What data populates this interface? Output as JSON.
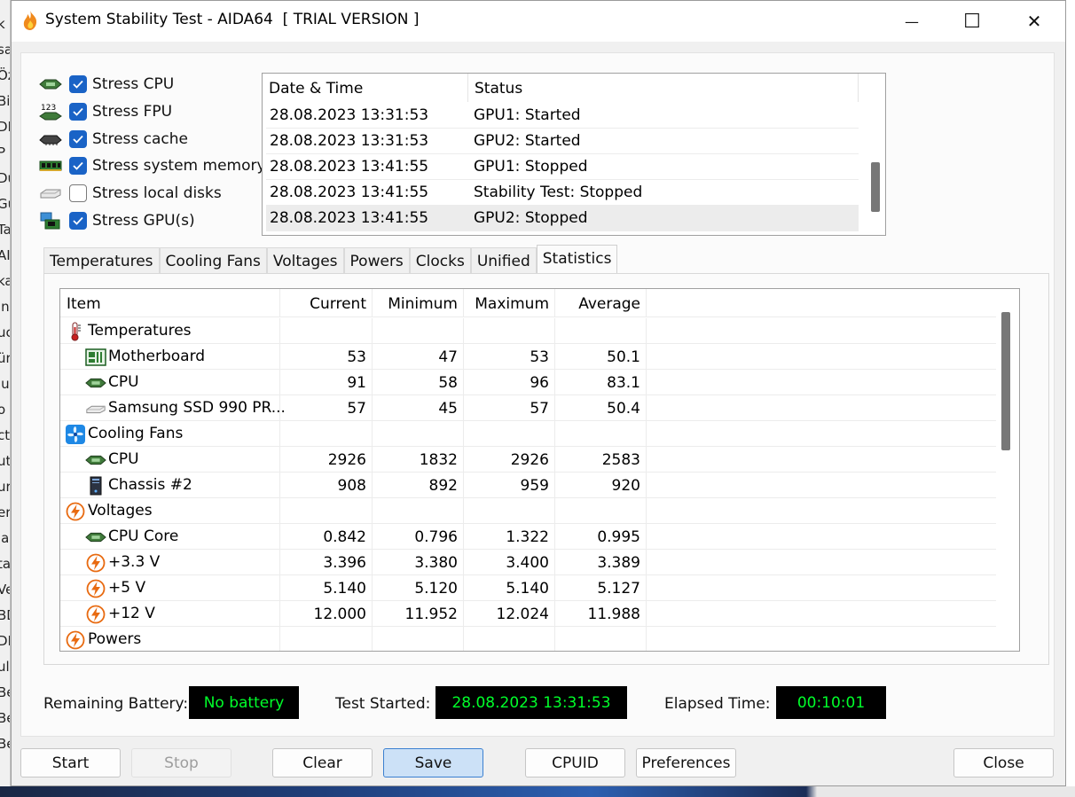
{
  "window": {
    "title": "System Stability Test - AIDA64  [ TRIAL VERSION ]",
    "minimize_glyph": "—",
    "maximize_glyph": "☐",
    "close_glyph": "✕"
  },
  "stress_options": [
    {
      "label": "Stress CPU",
      "checked": true,
      "icon": "cpu-chip-icon"
    },
    {
      "label": "Stress FPU",
      "checked": true,
      "icon": "fpu-icon"
    },
    {
      "label": "Stress cache",
      "checked": true,
      "icon": "cache-chip-icon"
    },
    {
      "label": "Stress system memory",
      "checked": true,
      "icon": "memory-module-icon"
    },
    {
      "label": "Stress local disks",
      "checked": false,
      "icon": "disk-icon"
    },
    {
      "label": "Stress GPU(s)",
      "checked": true,
      "icon": "gpu-icon"
    }
  ],
  "fpu_icon_text": "123",
  "log": {
    "headers": [
      "Date & Time",
      "Status"
    ],
    "rows": [
      {
        "time": "28.08.2023 13:31:53",
        "status": "GPU1: Started"
      },
      {
        "time": "28.08.2023 13:31:53",
        "status": "GPU2: Started"
      },
      {
        "time": "28.08.2023 13:41:55",
        "status": "GPU1: Stopped"
      },
      {
        "time": "28.08.2023 13:41:55",
        "status": "Stability Test: Stopped"
      },
      {
        "time": "28.08.2023 13:41:55",
        "status": "GPU2: Stopped"
      }
    ]
  },
  "tabs": [
    "Temperatures",
    "Cooling Fans",
    "Voltages",
    "Powers",
    "Clocks",
    "Unified",
    "Statistics"
  ],
  "active_tab": "Statistics",
  "stats": {
    "headers": {
      "item": "Item",
      "current": "Current",
      "minimum": "Minimum",
      "maximum": "Maximum",
      "average": "Average"
    },
    "rows": [
      {
        "type": "group",
        "icon": "thermometer-icon",
        "item": "Temperatures",
        "current": "",
        "minimum": "",
        "maximum": "",
        "average": ""
      },
      {
        "type": "item",
        "icon": "motherboard-icon",
        "item": "Motherboard",
        "current": "53",
        "minimum": "47",
        "maximum": "53",
        "average": "50.1"
      },
      {
        "type": "item",
        "icon": "cpu-chip-icon",
        "item": "CPU",
        "current": "91",
        "minimum": "58",
        "maximum": "96",
        "average": "83.1"
      },
      {
        "type": "item",
        "icon": "ssd-icon",
        "item": "Samsung SSD 990 PR...",
        "current": "57",
        "minimum": "45",
        "maximum": "57",
        "average": "50.4"
      },
      {
        "type": "group",
        "icon": "fan-icon",
        "item": "Cooling Fans",
        "current": "",
        "minimum": "",
        "maximum": "",
        "average": ""
      },
      {
        "type": "item",
        "icon": "cpu-chip-icon",
        "item": "CPU",
        "current": "2926",
        "minimum": "1832",
        "maximum": "2926",
        "average": "2583"
      },
      {
        "type": "item",
        "icon": "chassis-icon",
        "item": "Chassis #2",
        "current": "908",
        "minimum": "892",
        "maximum": "959",
        "average": "920"
      },
      {
        "type": "group",
        "icon": "voltage-icon",
        "item": "Voltages",
        "current": "",
        "minimum": "",
        "maximum": "",
        "average": ""
      },
      {
        "type": "item",
        "icon": "cpu-chip-icon",
        "item": "CPU Core",
        "current": "0.842",
        "minimum": "0.796",
        "maximum": "1.322",
        "average": "0.995"
      },
      {
        "type": "item",
        "icon": "voltage-icon",
        "item": "+3.3 V",
        "current": "3.396",
        "minimum": "3.380",
        "maximum": "3.400",
        "average": "3.389"
      },
      {
        "type": "item",
        "icon": "voltage-icon",
        "item": "+5 V",
        "current": "5.140",
        "minimum": "5.120",
        "maximum": "5.140",
        "average": "5.127"
      },
      {
        "type": "item",
        "icon": "voltage-icon",
        "item": "+12 V",
        "current": "12.000",
        "minimum": "11.952",
        "maximum": "12.024",
        "average": "11.988"
      },
      {
        "type": "group",
        "icon": "voltage-icon",
        "item": "Powers",
        "current": "",
        "minimum": "",
        "maximum": "",
        "average": ""
      }
    ]
  },
  "status": {
    "battery_label": "Remaining Battery:",
    "battery_value": "No battery",
    "started_label": "Test Started:",
    "started_value": "28.08.2023 13:31:53",
    "elapsed_label": "Elapsed Time:",
    "elapsed_value": "00:10:01"
  },
  "buttons": {
    "start": "Start",
    "stop": "Stop",
    "clear": "Clear",
    "save": "Save",
    "cpuid": "CPUID",
    "preferences": "Preferences",
    "close": "Close"
  },
  "background_text": [
    "k",
    "sa",
    "Öz",
    "Bil",
    "DI",
    "P",
    "Dü",
    "Gü",
    "Ta",
    "AI",
    "ka",
    "in",
    "uc",
    "ür",
    "lu",
    "o",
    "ct",
    "ut",
    "ur",
    "er",
    "la",
    "ta",
    "Ve",
    "BD",
    "DI",
    "ula",
    "Be",
    "Be",
    "Be"
  ],
  "colors": {
    "accent": "#1a63c6",
    "status_text": "#00ff2a",
    "status_bg": "#000000",
    "save_button_bg": "#cce1f7"
  }
}
